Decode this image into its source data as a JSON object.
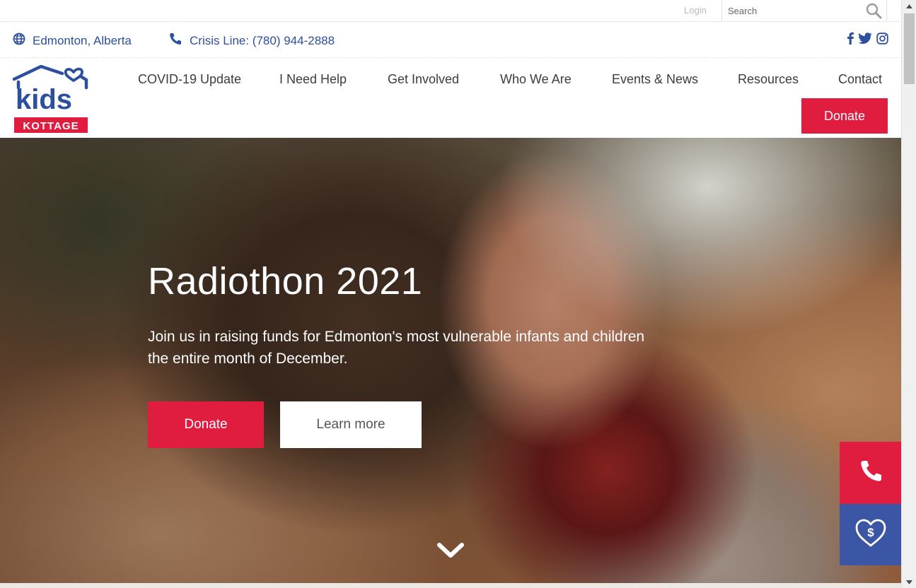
{
  "utility_bar": {
    "login_label": "Login",
    "search_placeholder": "Search"
  },
  "info_bar": {
    "location": "Edmonton, Alberta",
    "crisis_line": "Crisis Line: (780) 944-2888",
    "social_icons": [
      "facebook-icon",
      "twitter-icon",
      "instagram-icon"
    ]
  },
  "header": {
    "logo_text_top": "kids",
    "logo_text_bottom": "KOTTAGE",
    "nav": [
      {
        "label": "COVID-19 Update"
      },
      {
        "label": "I Need Help"
      },
      {
        "label": "Get Involved"
      },
      {
        "label": "Who We Are"
      },
      {
        "label": "Events & News"
      },
      {
        "label": "Resources"
      },
      {
        "label": "Contact"
      }
    ],
    "donate_label": "Donate"
  },
  "hero": {
    "title": "Radiothon 2021",
    "text": "Join us in raising funds for Edmonton's most vulnerable infants and children the entire month of December.",
    "donate_label": "Donate",
    "learn_more_label": "Learn more"
  },
  "floating": {
    "call_icon": "phone-icon",
    "donate_icon": "heart-dollar-icon"
  },
  "colors": {
    "brand_blue": "#2d4fa0",
    "brand_red": "#e11d3f",
    "widget_blue": "#3a56a4"
  }
}
